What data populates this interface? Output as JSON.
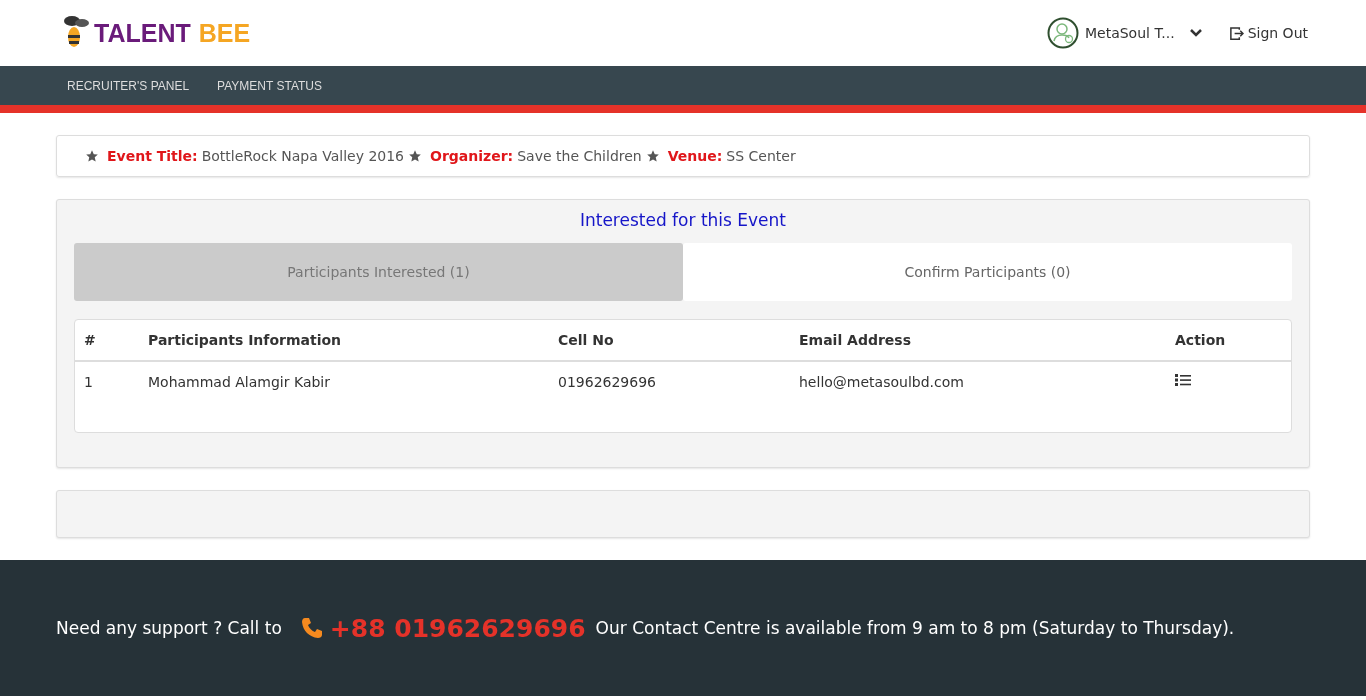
{
  "header": {
    "logo": {
      "part_1": "TALENT",
      "part_2": "BEE"
    },
    "user": {
      "name": "MetaSoul T..."
    },
    "sign_out": "Sign Out"
  },
  "nav": {
    "items": [
      {
        "label": "RECRUITER'S PANEL"
      },
      {
        "label": "PAYMENT STATUS"
      }
    ]
  },
  "event_info": [
    {
      "label": "Event Title:",
      "value": "BottleRock Napa Valley 2016"
    },
    {
      "label": "Organizer:",
      "value": "Save the Children"
    },
    {
      "label": "Venue:",
      "value": "SS Center"
    }
  ],
  "panel": {
    "title": "Interested for this Event",
    "tabs": [
      {
        "label": "Participants Interested (1)",
        "selected": true
      },
      {
        "label": "Confirm Participants (0)",
        "selected": false
      }
    ],
    "table": {
      "columns": [
        "#",
        "Participants Information",
        "Cell No",
        "Email Address",
        "Action"
      ],
      "rows": [
        {
          "number": "1",
          "name": "Mohammad Alamgir Kabir",
          "cell": "01962629696",
          "email": "hello@metasoulbd.com"
        }
      ]
    }
  },
  "footer": {
    "prefix": "Need any support ? Call to",
    "phone": "+88 01962629696",
    "suffix": "Our Contact Centre is available from 9 am to 8 pm (Saturday to Thursday)."
  }
}
